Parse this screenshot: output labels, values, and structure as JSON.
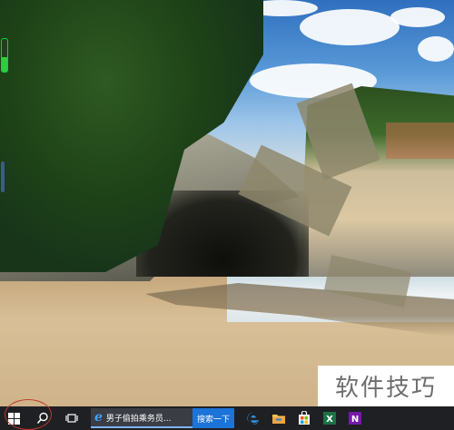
{
  "taskbar": {
    "browser_tab_title": "男子偷拍乘务员...",
    "search_button_label": "搜索一下"
  },
  "watermark": {
    "text": "软件技巧"
  },
  "icons": {
    "start": "windows-logo-icon",
    "search": "search-icon",
    "task_view": "task-view-icon",
    "ie": "internet-explorer-icon",
    "edge": "edge-icon",
    "explorer": "file-explorer-icon",
    "store": "store-icon",
    "excel": "excel-icon",
    "onenote": "onenote-icon"
  },
  "colors": {
    "taskbar_bg": "#1f2023",
    "search_button": "#1c73d8",
    "excel": "#1e7145",
    "onenote": "#7719aa",
    "annotation_circle": "#c0392b"
  }
}
